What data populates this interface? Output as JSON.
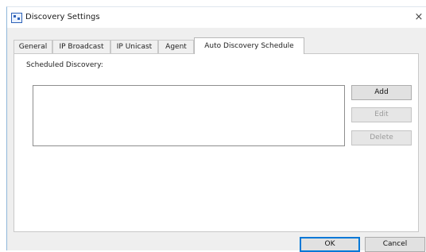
{
  "window": {
    "title": "Discovery Settings",
    "close_glyph": "×"
  },
  "tabs": [
    {
      "label": "General"
    },
    {
      "label": "IP Broadcast"
    },
    {
      "label": "IP Unicast"
    },
    {
      "label": "Agent"
    },
    {
      "label": "Auto Discovery Schedule",
      "active": true
    }
  ],
  "panel": {
    "section_label": "Scheduled Discovery:",
    "items": []
  },
  "buttons": {
    "add": "Add",
    "edit": "Edit",
    "delete": "Delete"
  },
  "footer": {
    "ok": "OK",
    "cancel": "Cancel"
  },
  "icons": {
    "app": "discovery-app-icon",
    "close": "close-icon"
  },
  "colors": {
    "accent": "#0078d7",
    "window_border": "#8fb7da",
    "dialog_bg": "#efefef"
  }
}
